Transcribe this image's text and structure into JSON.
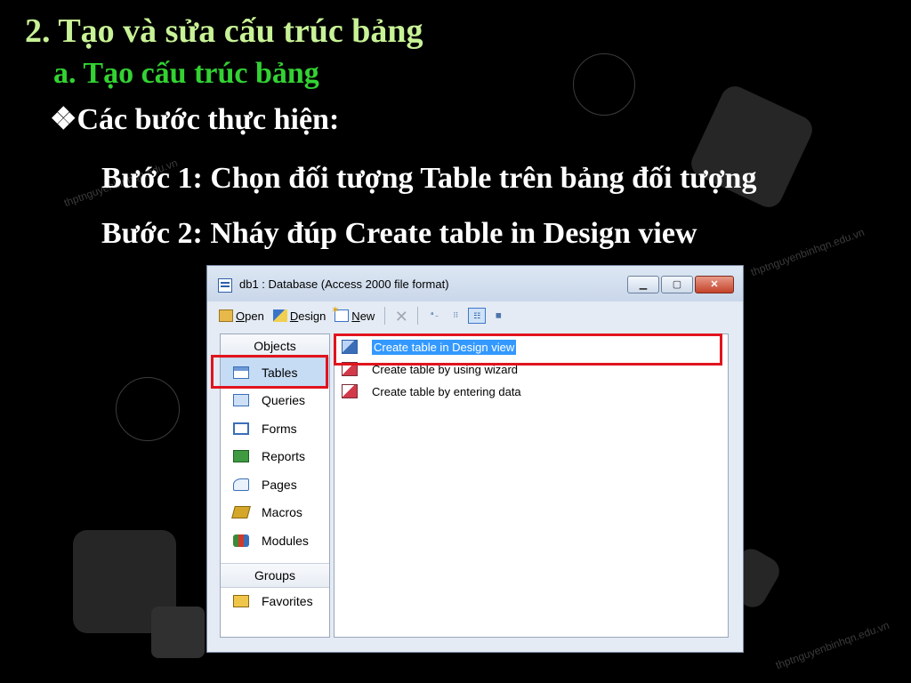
{
  "slide": {
    "title": "2. Tạo và sửa cấu trúc bảng",
    "subtitle": "a. Tạo cấu trúc bảng",
    "bullet_marker": "❖",
    "bullet_heading": "Các bước thực hiện:",
    "steps": [
      "Bước 1: Chọn đối tượng Table trên bảng đối tượng",
      "Bước 2: Nháy đúp Create table in Design view"
    ],
    "watermark": "thptnguyenbinhqn.edu.vn",
    "colors": {
      "title": "#c8f296",
      "subtitle": "#33d233",
      "highlight": "#e0141e"
    }
  },
  "window": {
    "title": "db1 : Database (Access 2000 file format)",
    "controls": {
      "minimize": "▁",
      "maximize": "▢",
      "close": "✕"
    },
    "toolbar": {
      "open_prefix": "",
      "open_hot": "O",
      "open_rest": "pen",
      "design_prefix": "",
      "design_hot": "D",
      "design_rest": "esign",
      "new_prefix": "",
      "new_hot": "N",
      "new_rest": "ew",
      "delete": "✕",
      "view_icons": [
        "ᵃ₋",
        "⁝⁝",
        "☷",
        "▦"
      ]
    },
    "objects_header": "Objects",
    "objects": [
      "Tables",
      "Queries",
      "Forms",
      "Reports",
      "Pages",
      "Macros",
      "Modules"
    ],
    "selected_object": "Tables",
    "groups_header": "Groups",
    "groups": [
      "Favorites"
    ],
    "list_items": [
      "Create table in Design view",
      "Create table by using wizard",
      "Create table by entering data"
    ]
  }
}
